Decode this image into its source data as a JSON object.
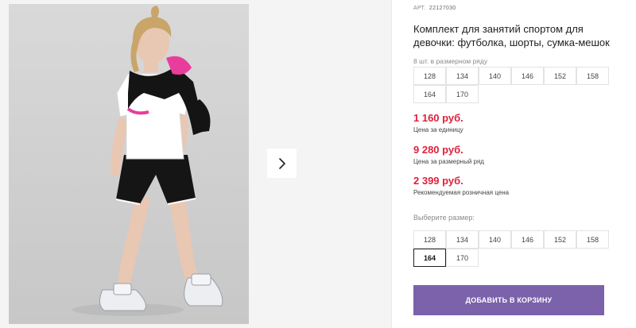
{
  "product": {
    "art_label": "АРТ.",
    "art_number": "22127030",
    "title": "Комплект для занятий спортом для девочки: футболка, шорты, сумка-мешок"
  },
  "pack": {
    "label": "8 шт. в размерном ряду",
    "sizes": [
      "128",
      "134",
      "140",
      "146",
      "152",
      "158",
      "164",
      "170"
    ]
  },
  "prices": [
    {
      "value": "1 160 руб.",
      "caption": "Цена за единицу"
    },
    {
      "value": "9 280 руб.",
      "caption": "Цена за размерный ряд"
    },
    {
      "value": "2 399 руб.",
      "caption": "Рекомендуемая розничная цена"
    }
  ],
  "size_select": {
    "label": "Выберите размер:",
    "sizes": [
      "128",
      "134",
      "140",
      "146",
      "152",
      "158",
      "164",
      "170"
    ],
    "selected": "164"
  },
  "cart_button": "ДОБАВИТЬ В КОРЗИНУ",
  "icons": {
    "next": "chevron-right-icon"
  },
  "colors": {
    "price": "#e0203b",
    "button": "#7b62aa"
  }
}
